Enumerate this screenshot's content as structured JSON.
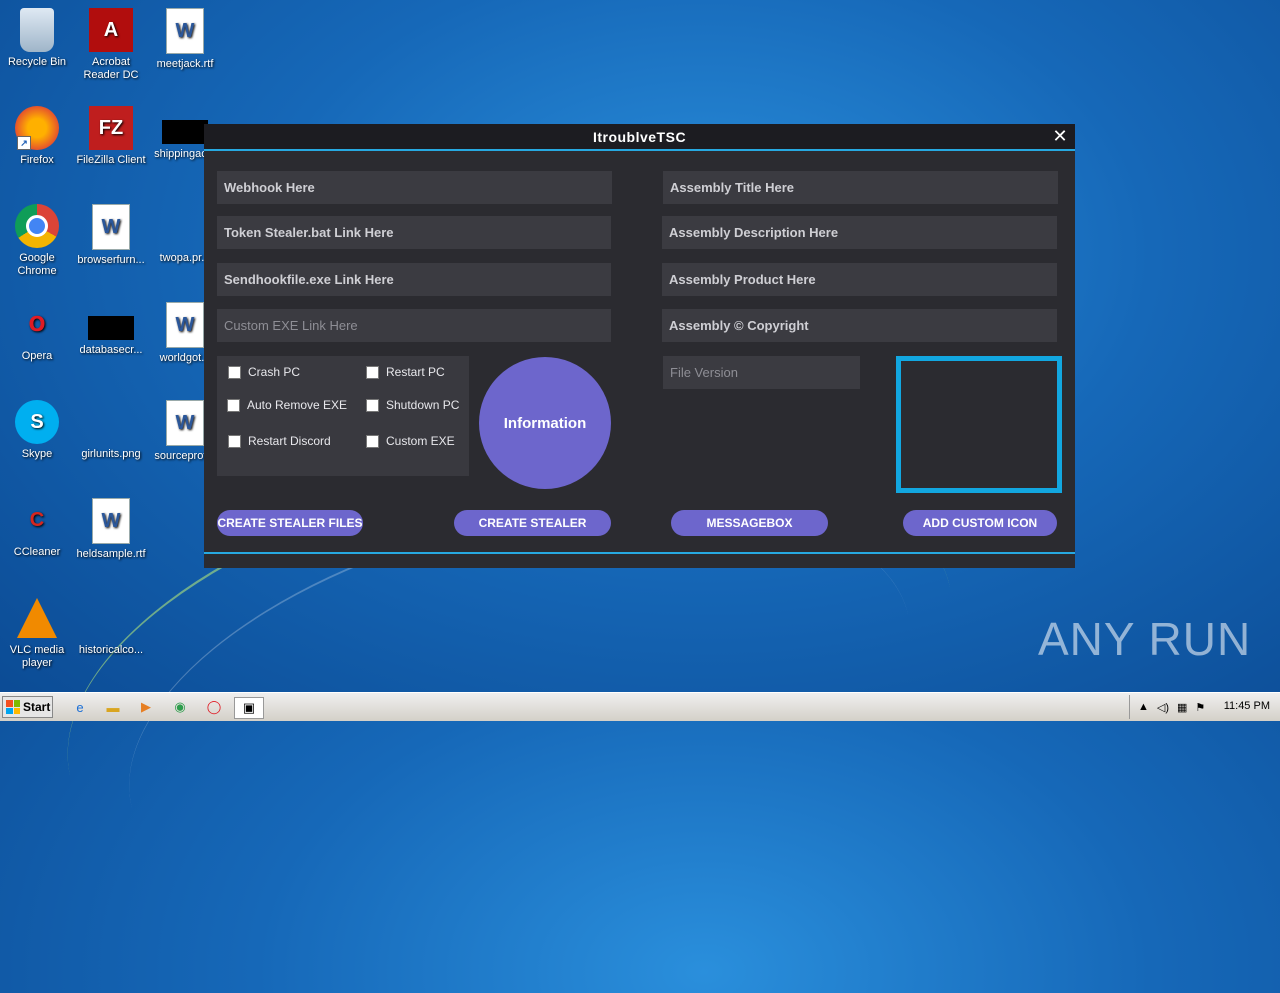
{
  "desktop": {
    "icons": [
      {
        "label": "Recycle Bin"
      },
      {
        "label": "Acrobat Reader DC"
      },
      {
        "label": "meetjack.rtf"
      },
      {
        "label": "Firefox"
      },
      {
        "label": "FileZilla Client"
      },
      {
        "label": "shippingac..."
      },
      {
        "label": "Google Chrome"
      },
      {
        "label": "browserfurn..."
      },
      {
        "label": "twopa.pr..."
      },
      {
        "label": "Opera"
      },
      {
        "label": "databasecr..."
      },
      {
        "label": "worldgot..."
      },
      {
        "label": "Skype"
      },
      {
        "label": "girlunits.png"
      },
      {
        "label": "sourceprot..."
      },
      {
        "label": "CCleaner"
      },
      {
        "label": "heldsample.rtf"
      },
      {
        "label": "VLC media player"
      },
      {
        "label": "historicalco..."
      }
    ],
    "watermark": "ANY RUN"
  },
  "window": {
    "title": "ItroublveTSC",
    "close_glyph": "✕",
    "fields": {
      "webhook": "Webhook Here",
      "token_stealer": "Token Stealer.bat Link Here",
      "sendhook": "Sendhookfile.exe Link Here",
      "custom_exe": "Custom EXE Link Here",
      "assembly_title": "Assembly Title Here",
      "assembly_description": "Assembly Description Here",
      "assembly_product": "Assembly Product Here",
      "assembly_copyright": "Assembly © Copyright",
      "file_version": "File Version"
    },
    "options": {
      "crash_pc": "Crash PC",
      "restart_pc": "Restart PC",
      "auto_remove_exe": "Auto Remove EXE",
      "shutdown_pc": "Shutdown PC",
      "restart_discord": "Restart Discord",
      "custom_exe": "Custom EXE"
    },
    "information_button": "Information",
    "buttons": {
      "create_stealer_files": "CREATE STEALER FILES",
      "create_stealer": "CREATE STEALER",
      "messagebox": "MESSAGEBOX",
      "add_custom_icon": "ADD CUSTOM ICON"
    },
    "colors": {
      "accent": "#27a9e1",
      "button": "#6d66cc",
      "background": "#2b2b30"
    }
  },
  "taskbar": {
    "start_label": "Start",
    "time": "11:45 PM"
  }
}
